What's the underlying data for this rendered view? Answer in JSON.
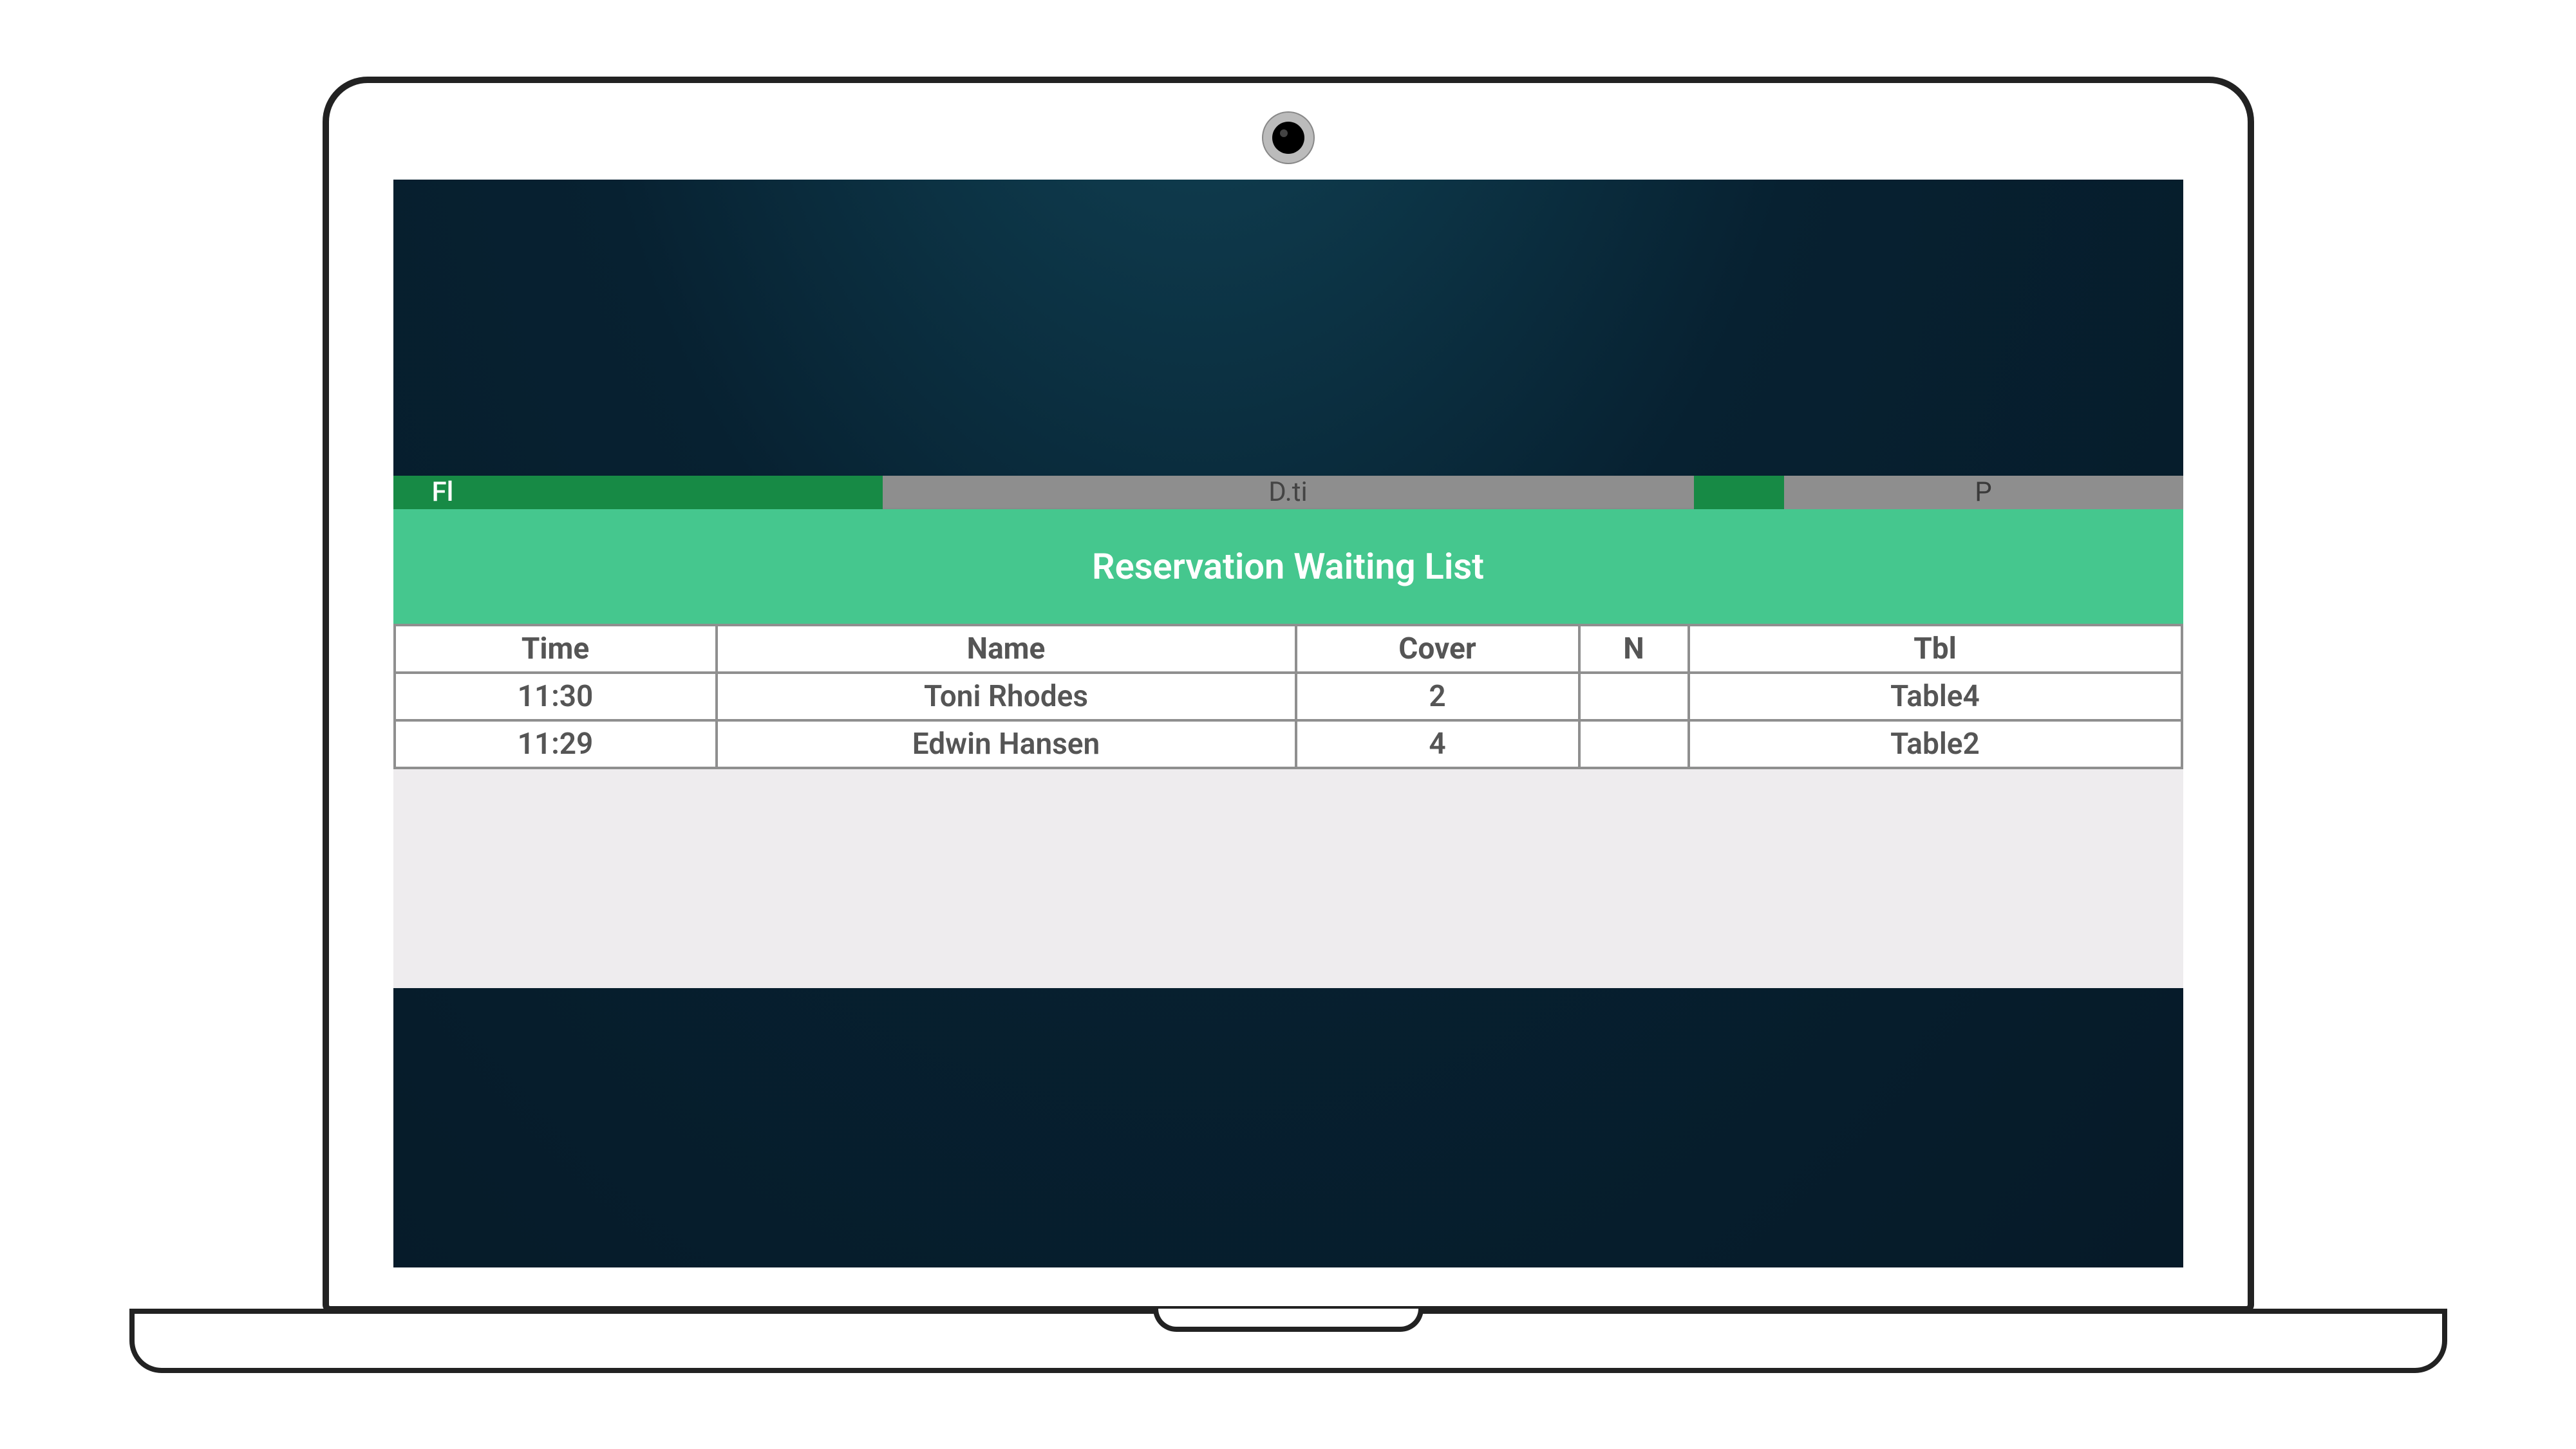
{
  "colors": {
    "accent": "#45c78e",
    "tab_green": "#178a45",
    "tab_gray": "#8e8e8e",
    "border_gray": "#8f8f8f",
    "panel_bg": "#eeecee"
  },
  "header": {
    "tab_left_partial": "Fl",
    "tab_middle_partial": "D.ti",
    "tab_right_partial": "P",
    "title": "Reservation Waiting List"
  },
  "table": {
    "headers": {
      "time": "Time",
      "name": "Name",
      "cover": "Cover",
      "n": "N",
      "tbl": "Tbl"
    },
    "rows": [
      {
        "time": "11:30",
        "name": "Toni Rhodes",
        "cover": "2",
        "n": "",
        "tbl": "Table4"
      },
      {
        "time": "11:29",
        "name": "Edwin Hansen",
        "cover": "4",
        "n": "",
        "tbl": "Table2"
      }
    ]
  }
}
